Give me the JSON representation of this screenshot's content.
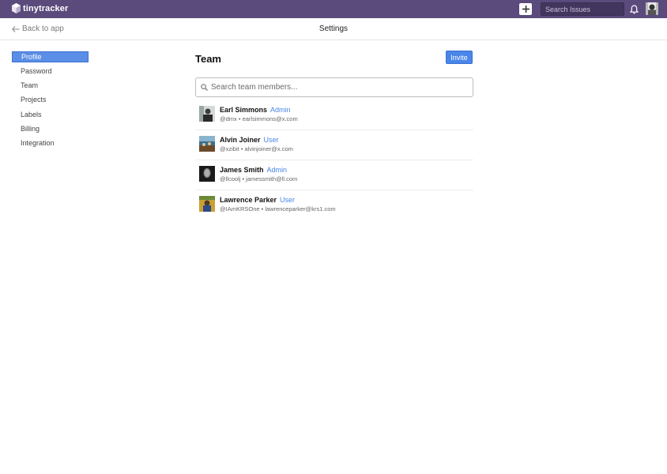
{
  "app": {
    "name": "tinytracker"
  },
  "topbar": {
    "new_issue_icon": "plus-icon",
    "search_placeholder": "Search Issues",
    "notifications_icon": "bell-icon",
    "colors": {
      "bar": "#5b4a7c"
    }
  },
  "subheader": {
    "back_label": "Back to app",
    "title": "Settings"
  },
  "sidebar": {
    "items": [
      {
        "label": "Profile",
        "active": true
      },
      {
        "label": "Password"
      },
      {
        "label": "Team"
      },
      {
        "label": "Projects"
      },
      {
        "label": "Labels"
      },
      {
        "label": "Billing"
      },
      {
        "label": "Integration"
      }
    ]
  },
  "team": {
    "title": "Team",
    "invite_label": "Invite",
    "search_placeholder": "Search team members...",
    "members": [
      {
        "name": "Earl Simmons",
        "role": "Admin",
        "handle": "@dmx",
        "email": "earlsimmons@x.com"
      },
      {
        "name": "Alvin Joiner",
        "role": "User",
        "handle": "@xzibit",
        "email": "alvinjoiner@x.com"
      },
      {
        "name": "James Smith",
        "role": "Admin",
        "handle": "@llcoolj",
        "email": "jamessmith@ll.com"
      },
      {
        "name": "Lawrence Parker",
        "role": "User",
        "handle": "@IAmKRSOne",
        "email": "lawrenceparker@krs1.com"
      }
    ]
  },
  "colors": {
    "accent": "#4a86e8",
    "active_item": "#5b8ee6"
  }
}
